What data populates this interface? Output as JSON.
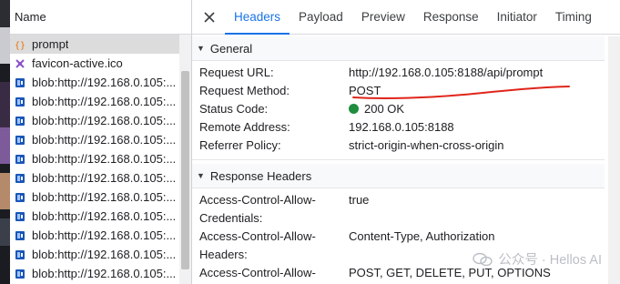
{
  "name_panel": {
    "header": "Name",
    "rows": [
      {
        "label": "prompt",
        "icon": "fetch-icon",
        "selected": true
      },
      {
        "label": "favicon-active.ico",
        "icon": "image-icon",
        "selected": false
      },
      {
        "label": "blob:http://192.168.0.105:...",
        "icon": "blob-icon",
        "selected": false
      },
      {
        "label": "blob:http://192.168.0.105:...",
        "icon": "blob-icon",
        "selected": false
      },
      {
        "label": "blob:http://192.168.0.105:...",
        "icon": "blob-icon",
        "selected": false
      },
      {
        "label": "blob:http://192.168.0.105:...",
        "icon": "blob-icon",
        "selected": false
      },
      {
        "label": "blob:http://192.168.0.105:...",
        "icon": "blob-icon",
        "selected": false
      },
      {
        "label": "blob:http://192.168.0.105:...",
        "icon": "blob-icon",
        "selected": false
      },
      {
        "label": "blob:http://192.168.0.105:...",
        "icon": "blob-icon",
        "selected": false
      },
      {
        "label": "blob:http://192.168.0.105:...",
        "icon": "blob-icon",
        "selected": false
      },
      {
        "label": "blob:http://192.168.0.105:...",
        "icon": "blob-icon",
        "selected": false
      },
      {
        "label": "blob:http://192.168.0.105:...",
        "icon": "blob-icon",
        "selected": false
      },
      {
        "label": "blob:http://192.168.0.105:...",
        "icon": "blob-icon",
        "selected": false
      }
    ]
  },
  "tabs": [
    "Headers",
    "Payload",
    "Preview",
    "Response",
    "Initiator",
    "Timing"
  ],
  "active_tab": "Headers",
  "general": {
    "title": "General",
    "request_url_label": "Request URL:",
    "request_url": "http://192.168.0.105:8188/api/prompt",
    "request_method_label": "Request Method:",
    "request_method": "POST",
    "status_code_label": "Status Code:",
    "status_code": "200 OK",
    "remote_address_label": "Remote Address:",
    "remote_address": "192.168.0.105:8188",
    "referrer_policy_label": "Referrer Policy:",
    "referrer_policy": "strict-origin-when-cross-origin"
  },
  "response_headers": {
    "title": "Response Headers",
    "allow_credentials_label_1": "Access-Control-Allow-",
    "allow_credentials_label_2": "Credentials:",
    "allow_credentials": "true",
    "allow_headers_label_1": "Access-Control-Allow-",
    "allow_headers_label_2": "Headers:",
    "allow_headers": "Content-Type, Authorization",
    "allow_methods_label_1": "Access-Control-Allow-",
    "allow_methods": "POST, GET, DELETE, PUT, OPTIONS"
  },
  "watermark": "公众号 · Hellos AI",
  "colors": {
    "accent": "#1a73e8",
    "status_ok": "#1e8e3e",
    "annotation": "#e0251b",
    "fetch_icon": "#e8710a",
    "blob_icon": "#1a56b8"
  }
}
